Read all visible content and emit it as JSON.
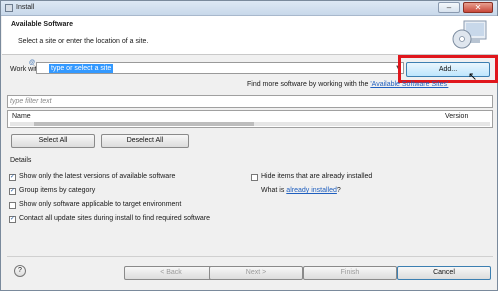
{
  "window": {
    "title": "Install"
  },
  "banner": {
    "title": "Available Software",
    "subtitle": "Select a site or enter the location of a site."
  },
  "work_with": {
    "label": "Work with:",
    "value": "type or select a site",
    "hint": "@",
    "add_label": "Add..."
  },
  "find_more": {
    "prefix": "Find more software by working with the ",
    "link": "'Available Software Sites'"
  },
  "filter": {
    "placeholder": "type filter text"
  },
  "table": {
    "columns": [
      "Name",
      "Version"
    ]
  },
  "buttons": {
    "select_all": "Select All",
    "deselect_all": "Deselect All"
  },
  "details": {
    "label": "Details",
    "options": [
      {
        "label": "Show only the latest versions of available software",
        "checked": true
      },
      {
        "label": "Group items by category",
        "checked": true
      },
      {
        "label": "Show only software applicable to target environment",
        "checked": false
      },
      {
        "label": "Contact all update sites during install to find required software",
        "checked": true
      },
      {
        "label": "Hide items that are already installed",
        "checked": false
      }
    ],
    "what_is_prefix": "What is ",
    "what_is_link": "already installed",
    "what_is_suffix": "?"
  },
  "footer": {
    "help": "?",
    "back": "< Back",
    "next": "Next >",
    "finish": "Finish",
    "cancel": "Cancel"
  }
}
